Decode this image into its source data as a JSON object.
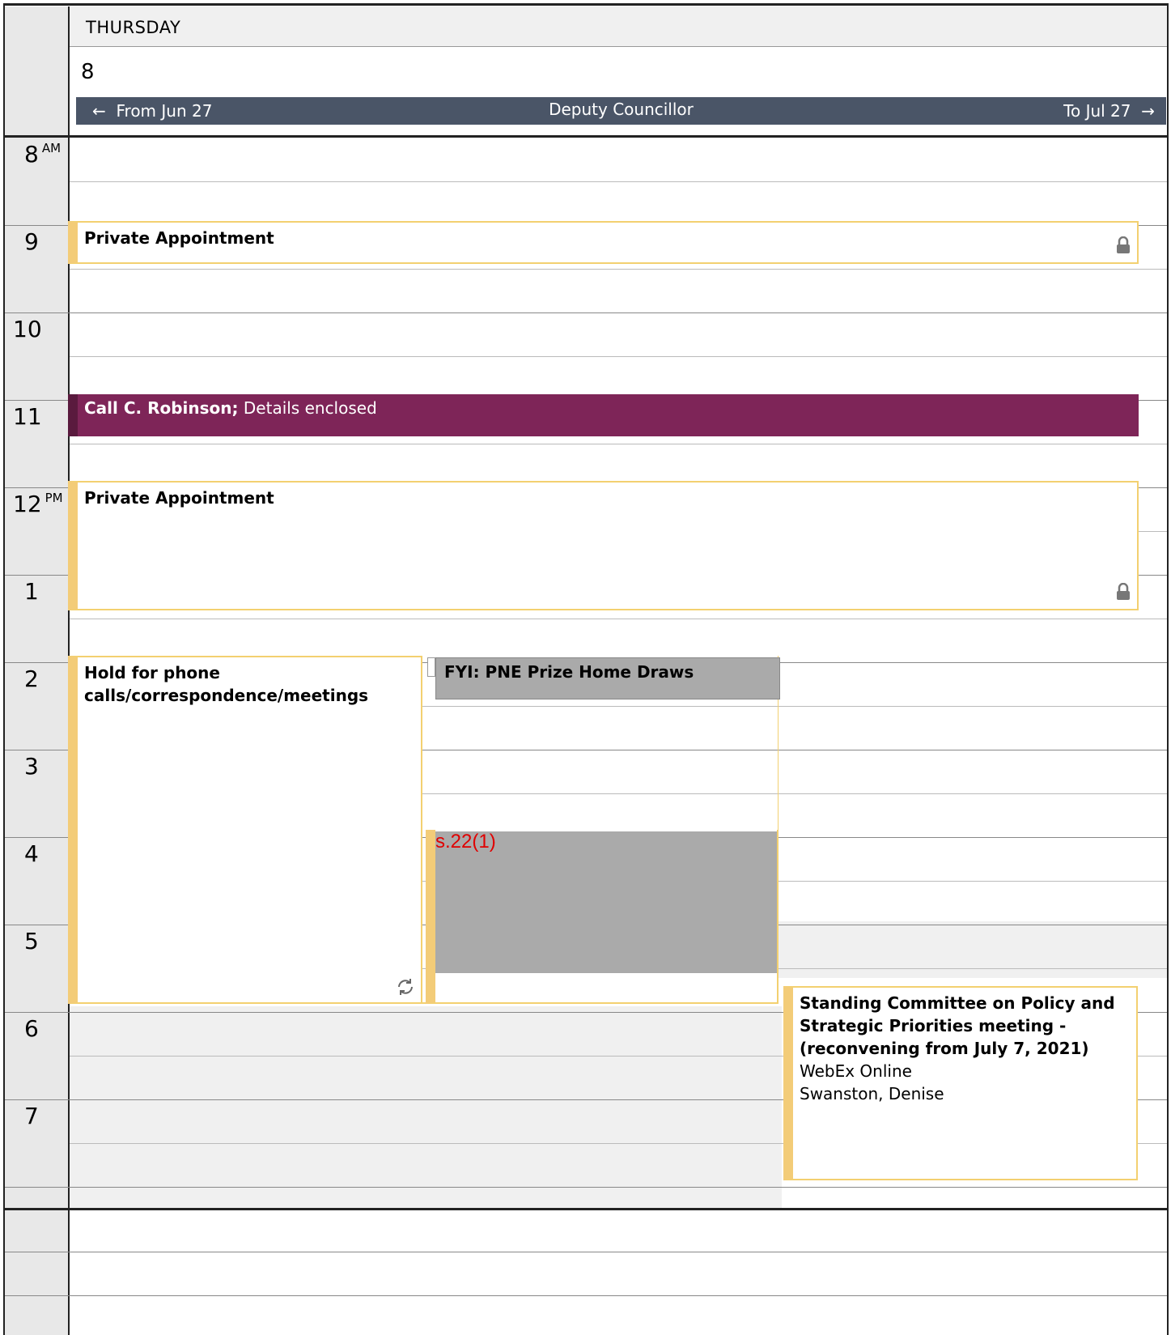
{
  "day": {
    "name": "THURSDAY",
    "number": "8"
  },
  "banner": {
    "from": "From Jun 27",
    "title": "Deputy Councillor",
    "to": "To Jul 27"
  },
  "hours": [
    {
      "label": "8",
      "suffix": "AM"
    },
    {
      "label": "9",
      "suffix": ""
    },
    {
      "label": "10",
      "suffix": ""
    },
    {
      "label": "11",
      "suffix": ""
    },
    {
      "label": "12",
      "suffix": "PM"
    },
    {
      "label": "1",
      "suffix": ""
    },
    {
      "label": "2",
      "suffix": ""
    },
    {
      "label": "3",
      "suffix": ""
    },
    {
      "label": "4",
      "suffix": ""
    },
    {
      "label": "5",
      "suffix": ""
    },
    {
      "label": "6",
      "suffix": ""
    },
    {
      "label": "7",
      "suffix": ""
    }
  ],
  "events": {
    "private1": {
      "title": "Private Appointment"
    },
    "call": {
      "title": "Call C. Robinson;",
      "detail": "Details enclosed"
    },
    "private2": {
      "title": "Private Appointment"
    },
    "hold": {
      "title": "Hold for phone calls/correspondence/meetings"
    },
    "fyi": {
      "title": "FYI: PNE Prize Home Draws"
    },
    "redacted": {
      "label": "s.22(1)"
    },
    "standing": {
      "title": "Standing Committee on Policy and Strategic Priorities meeting - (reconvening from July 7, 2021)",
      "location": "WebEx Online",
      "organizer": "Swanston, Denise"
    }
  },
  "colors": {
    "banner": "#4a5567",
    "call": "#7e2558",
    "tentative": "#f3cc78",
    "redaction": "#aaaaaa"
  }
}
